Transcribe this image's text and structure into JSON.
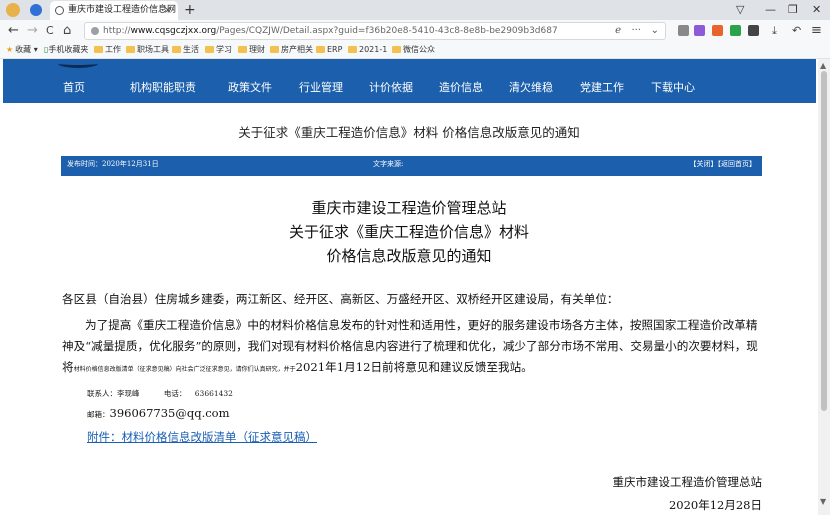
{
  "browser": {
    "tab_title": "重庆市建设工程造价信息网",
    "tab_close": "×",
    "new_tab": "+",
    "url_host": "www.cqsgczjxx.org",
    "url_prefix": "http://",
    "url_path": "/Pages/CQZJW/Detail.aspx?guid=f36b20e8-5410-43c8-8e8b-be2909b3d687",
    "window_controls": [
      "▽",
      "—",
      "❐",
      "✕"
    ],
    "nav": [
      "←",
      "→",
      "C",
      "⌂"
    ],
    "url_right": [
      "ℯ",
      "···",
      "⌄"
    ],
    "bookmarks": [
      {
        "label": "收藏",
        "icon": "star-icon"
      },
      {
        "label": "手机收藏夹",
        "icon": "phone-icon"
      },
      {
        "label": "工作",
        "icon": "folder-icon"
      },
      {
        "label": "职场工具",
        "icon": "folder-icon"
      },
      {
        "label": "生活",
        "icon": "folder-icon"
      },
      {
        "label": "学习",
        "icon": "folder-icon"
      },
      {
        "label": "理财",
        "icon": "folder-icon"
      },
      {
        "label": "房产相关",
        "icon": "folder-icon"
      },
      {
        "label": "ERP",
        "icon": "folder-icon"
      },
      {
        "label": "2021-1",
        "icon": "folder-icon"
      },
      {
        "label": "微信公众",
        "icon": "folder-icon"
      }
    ]
  },
  "site": {
    "menu": [
      "首页",
      "机构职能职责",
      "政策文件",
      "行业管理",
      "计价依据",
      "造价信息",
      "清欠维稳",
      "党建工作",
      "下载中心"
    ]
  },
  "article": {
    "page_title": "关于征求《重庆工程造价信息》材料 价格信息改版意见的通知",
    "publish_time": "发布时间：2020年12月31日",
    "source": "文字来源:",
    "actions": "【关闭】【返回首页】",
    "heading_lines": [
      "重庆市建设工程造价管理总站",
      "关于征求《重庆工程造价信息》材料",
      "价格信息改版意见的通知"
    ],
    "salutation": "各区县（自治县）住房城乡建委，两江新区、经开区、高新区、万盛经开区、双桥经开区建设局，有关单位：",
    "para_main": "为了提高《重庆工程造价信息》中的材料价格信息发布的针对性和适用性，更好的服务建设市场各方主体，按照国家工程造价改革精神及“减量提质，优化服务”的原则，我们对现有材料价格信息内容进行了梳理和优化，减少了部分市场不常用、交易量小的次要材料，现将",
    "para_small": "材料价格信息改版清单（征求意见稿）向社会广泛征求意见，请你们认真研究，并于",
    "para_end": "2021年1月12日前将意见和建议反馈至我站。",
    "contact_person": "联系人：李现峰",
    "contact_phone": "电话：",
    "phone_number": "63661432",
    "email_label": "邮箱：",
    "email": "396067735@qq.com",
    "attachment": "附件：材料价格信息改版清单（征求意见稿）",
    "signature": "重庆市建设工程造价管理总站",
    "date": "2020年12月28日"
  }
}
